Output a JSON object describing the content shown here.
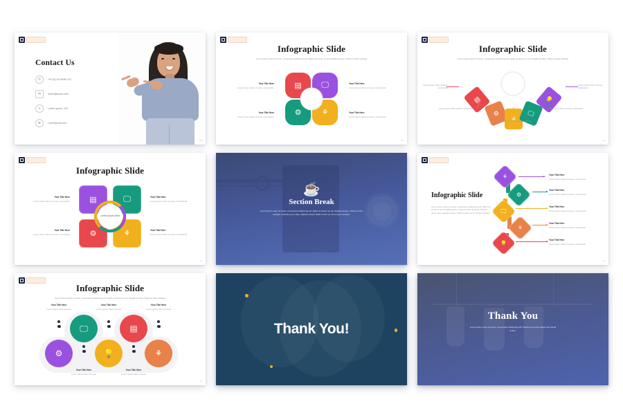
{
  "deck": {
    "brand_badge": {
      "mark": "logo-mark",
      "wordmark": "Lorem Ipsum"
    },
    "colors": {
      "red": "#E8474B",
      "purple": "#9B51E0",
      "teal": "#179B7E",
      "amber": "#F2B01E",
      "orange": "#E8814A",
      "navy": "#1d4360",
      "slate_blue": "#4b5a92"
    }
  },
  "slides": [
    {
      "id": "contact-us",
      "page": "09",
      "heading": "Contact Us",
      "items": [
        {
          "icon": "phone-icon",
          "text": "+91 (0) 30 00048 127"
        },
        {
          "icon": "envelope-icon",
          "text": "lorem@ipsum.com"
        },
        {
          "icon": "location-pin-icon",
          "text": "Lorem Ipsum, 120"
        },
        {
          "icon": "globe-icon",
          "text": "Loremipsum.com"
        }
      ],
      "photo_alt": "woman-pointing-photo"
    },
    {
      "id": "infographic-flower",
      "page": "10",
      "title": "Infographic Slide",
      "subtitle": "Lorem ipsum dolor sit amet, consectetur adipiscing elit. Etiam ac ipsum ex leo fringilla tempus. Nulla ac dolor tristique",
      "petals": [
        {
          "color": "#E8474B",
          "icon": "calculator-icon",
          "position": "top-left"
        },
        {
          "color": "#9B51E0",
          "icon": "presentation-icon",
          "position": "top-right"
        },
        {
          "color": "#179B7E",
          "icon": "gear-icon",
          "position": "bottom-left"
        },
        {
          "color": "#F2B01E",
          "icon": "hand-plant-icon",
          "position": "bottom-right"
        }
      ],
      "labels": [
        {
          "title": "Your Title Here",
          "body": "Lorem ipsum dolor sit amet, consectetur"
        },
        {
          "title": "Your Title Here",
          "body": "Lorem ipsum dolor sit amet, consectetur"
        },
        {
          "title": "Your Title Here",
          "body": "Lorem ipsum dolor sit amet, consectetur"
        },
        {
          "title": "Your Title Here",
          "body": "Lorem ipsum dolor sit amet, consectetur"
        }
      ]
    },
    {
      "id": "infographic-fan",
      "page": "11",
      "title": "Infographic Slide",
      "subtitle": "Lorem ipsum dolor sit amet, consectetur adipiscing elit. Etiam ac ipsum ex leo fringilla tempus. Nulla ac dolor tristique",
      "segments": [
        {
          "color": "#E8474B",
          "icon": "calculator-icon",
          "body": "Lorem ipsum dolor sit amet, consectetur"
        },
        {
          "color": "#E8814A",
          "icon": "gear-icon",
          "body": "Lorem ipsum dolor sit amet, consectetur"
        },
        {
          "color": "#F2B01E",
          "icon": "hand-plant-icon",
          "body": "Lorem ipsum dolor sit amet, consectetur"
        },
        {
          "color": "#179B7E",
          "icon": "presentation-icon",
          "body": "Lorem ipsum dolor sit amet, consectetur"
        },
        {
          "color": "#9B51E0",
          "icon": "lightbulb-icon",
          "body": "Lorem ipsum dolor sit amet, consectetur"
        }
      ]
    },
    {
      "id": "infographic-quad",
      "page": "12",
      "title": "Infographic Slide",
      "center_text": "Lorem Ipsum dolor",
      "tiles": [
        {
          "color": "#9B51E0",
          "icon": "calculator-icon",
          "position": "top-left"
        },
        {
          "color": "#179B7E",
          "icon": "presentation-icon",
          "position": "top-right"
        },
        {
          "color": "#E8474B",
          "icon": "gear-icon",
          "position": "bottom-left"
        },
        {
          "color": "#F2B01E",
          "icon": "hand-plant-icon",
          "position": "bottom-right"
        }
      ],
      "labels": [
        {
          "title": "Your Title Here",
          "body": "Lorem ipsum dolor sit amet, consectetur"
        },
        {
          "title": "Your Title Here",
          "body": "Lorem ipsum dolor sit amet, consectetur"
        },
        {
          "title": "Your Title Here",
          "body": "Lorem ipsum dolor sit amet, consectetur"
        },
        {
          "title": "Your Title Here",
          "body": "Lorem ipsum dolor sit amet, consectetur"
        }
      ]
    },
    {
      "id": "section-break",
      "page": "13",
      "icon": "coffee-cup-icon",
      "title": "Section Break",
      "body": "Lorem ipsum dolor sit amet, consectetur adipiscing elit. Etiam ac ipsum ac leo fringilla tempus. Nulla ac dolor tristique, lobortis purus vitae, aliquam lectus. Nulla a odio vel nisi tempor volutpat."
    },
    {
      "id": "infographic-chain",
      "page": "14",
      "title": "Infographic Slide",
      "body": "Lorem ipsum dolor sit amet, consectetur adipiscing elit. Etiam ac ipsum ac leo fringilla tempus. Nulla ac dolor tristique, lobortis purus vitae, aliquam lectus. Nulla a odio vel nisi tempor volutpat.",
      "steps": [
        {
          "color": "#9B51E0",
          "icon": "hand-plant-icon",
          "title": "Your Title Here",
          "body": "Lorem ipsum dolor sit amet, consectetur"
        },
        {
          "color": "#179B7E",
          "icon": "gear-icon",
          "title": "Your Title Here",
          "body": "Lorem ipsum dolor sit amet, consectetur"
        },
        {
          "color": "#F2B01E",
          "icon": "presentation-icon",
          "title": "Your Title Here",
          "body": "Lorem ipsum dolor sit amet, consectetur"
        },
        {
          "color": "#E8814A",
          "icon": "hand-plant-icon",
          "title": "Your Title Here",
          "body": "Lorem ipsum dolor sit amet, consectetur"
        },
        {
          "color": "#E8474B",
          "icon": "lightbulb-icon",
          "title": "Your Title Here",
          "body": "Lorem ipsum dolor sit amet, consectetur"
        }
      ]
    },
    {
      "id": "infographic-circles",
      "page": "15",
      "title": "Infographic Slide",
      "subtitle": "Lorem ipsum dolor sit amet, consectetur adipiscing elit. Etiam ac ipsum ac leo fringilla tempus. Nulla ac dolor tristique",
      "nodes": [
        {
          "color": "#179B7E",
          "icon": "presentation-icon",
          "title": "Your Title Here",
          "body": "Lorem ipsum dolor sit amet"
        },
        {
          "color": "#E8474B",
          "icon": "calculator-icon",
          "title": "Your Title Here",
          "body": "Lorem ipsum dolor sit amet"
        },
        {
          "color": "#9B51E0",
          "icon": "gear-icon",
          "title": "Your Title Here",
          "body": "Lorem ipsum dolor sit amet"
        },
        {
          "color": "#F2B01E",
          "icon": "lightbulb-icon",
          "title": "Your Title Here",
          "body": "Lorem ipsum dolor sit amet"
        },
        {
          "color": "#E8814A",
          "icon": "hand-plant-icon",
          "title": "Your Title Here",
          "body": "Lorem ipsum dolor sit amet"
        }
      ]
    },
    {
      "id": "thank-you-dark",
      "page": "16",
      "title": "Thank You!"
    },
    {
      "id": "thank-you-gradient",
      "page": "17",
      "title": "Thank You",
      "body": "Lorem ipsum dolor sit amet, consectetur adipiscing elit. Praesent sit amet aliquet elit. Morbi pellen."
    }
  ]
}
